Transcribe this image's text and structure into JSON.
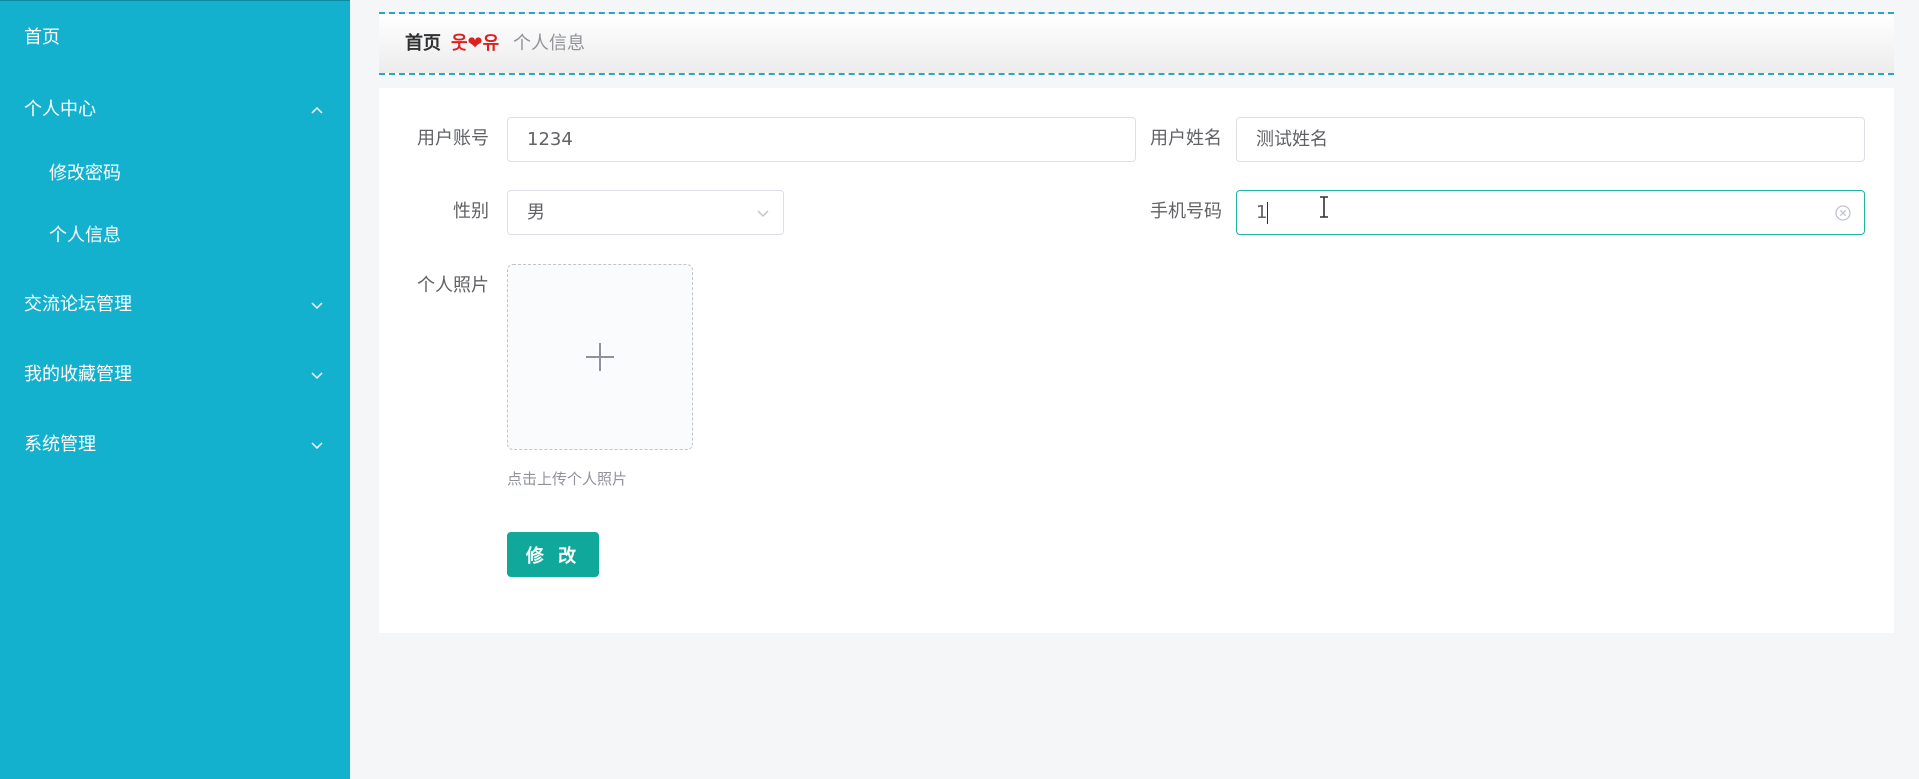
{
  "sidebar": {
    "items": [
      {
        "label": "首页",
        "expandable": false
      },
      {
        "label": "个人中心",
        "expandable": true,
        "expanded": true,
        "children": [
          {
            "label": "修改密码"
          },
          {
            "label": "个人信息"
          }
        ]
      },
      {
        "label": "交流论坛管理",
        "expandable": true,
        "expanded": false
      },
      {
        "label": "我的收藏管理",
        "expandable": true,
        "expanded": false
      },
      {
        "label": "系统管理",
        "expandable": true,
        "expanded": false
      }
    ]
  },
  "breadcrumb": {
    "home": "首页",
    "separator": "웃❤유",
    "current": "个人信息"
  },
  "form": {
    "account": {
      "label": "用户账号",
      "value": "1234"
    },
    "name": {
      "label": "用户姓名",
      "value": "测试姓名"
    },
    "gender": {
      "label": "性别",
      "value": "男"
    },
    "phone": {
      "label": "手机号码",
      "value": "1"
    },
    "photo": {
      "label": "个人照片",
      "hint": "点击上传个人照片"
    },
    "submit_label": "修 改"
  },
  "colors": {
    "sidebar_bg": "#14b1cf",
    "primary_button": "#0fa89a",
    "focus_border": "#1fb4a1",
    "breadcrumb_separator": "#e02020"
  },
  "icons": {
    "expanded": "chevron-up-icon",
    "collapsed": "chevron-down-icon",
    "select": "chevron-down-icon",
    "clear": "clear-circle-icon",
    "upload": "plus-icon",
    "cursor": "i-beam-cursor-icon"
  }
}
